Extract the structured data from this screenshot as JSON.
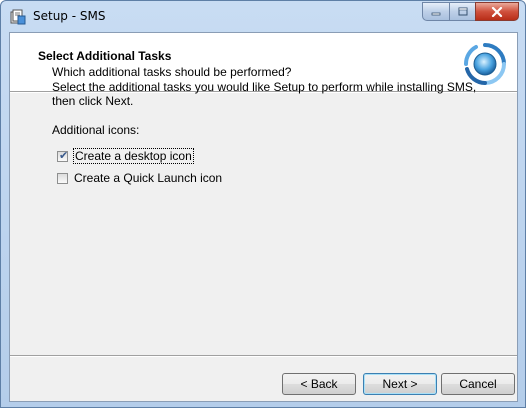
{
  "window": {
    "title": "Setup - SMS",
    "controls": {
      "minimize": "minimize-icon",
      "maximize": "maximize-icon",
      "close": "close-icon"
    }
  },
  "header": {
    "title": "Select Additional Tasks",
    "subtitle": "Which additional tasks should be performed?"
  },
  "content": {
    "description": "Select the additional tasks you would like Setup to perform while installing SMS, then click Next.",
    "group_label": "Additional icons:",
    "tasks": [
      {
        "label": "Create a desktop icon",
        "checked": true
      },
      {
        "label": "Create a Quick Launch icon",
        "checked": false
      }
    ]
  },
  "buttons": {
    "back": "< Back",
    "next": "Next >",
    "cancel": "Cancel"
  },
  "colors": {
    "title_bar": "#b9d1ea",
    "close_button": "#c9462f",
    "dialog_bg": "#f0f0f0",
    "default_button_border": "#3c7fb1"
  }
}
